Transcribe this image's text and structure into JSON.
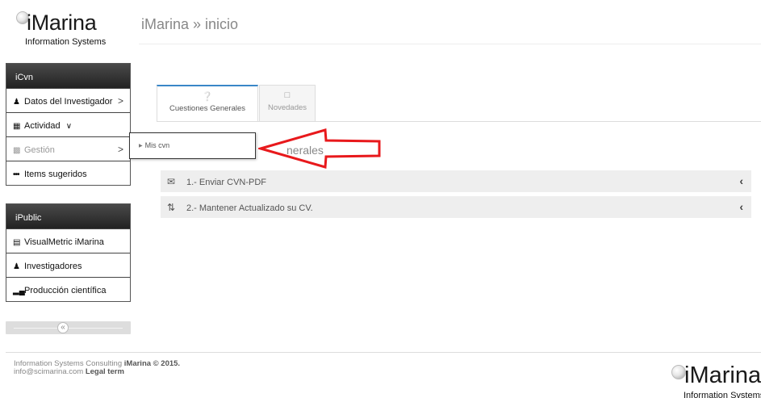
{
  "logo": {
    "brand": "iMarina",
    "subtitle": "Information Systems"
  },
  "page_title": "iMarina » inicio",
  "sidebar": {
    "icvn": {
      "header": "iCvn",
      "items": [
        {
          "label": "Datos del Investigador",
          "icon": "user-icon",
          "suffix": ">"
        },
        {
          "label": "Actividad",
          "icon": "document-icon",
          "suffix": "∨"
        },
        {
          "label": "Gestión",
          "icon": "briefcase-icon",
          "suffix": ">"
        },
        {
          "label": "Items sugeridos",
          "icon": "ellipsis-icon"
        }
      ]
    },
    "ipublic": {
      "header": "iPublic",
      "items": [
        {
          "label": "VisualMetric iMarina",
          "icon": "chart-icon"
        },
        {
          "label": "Investigadores",
          "icon": "users-icon"
        },
        {
          "label": "Producción científica",
          "icon": "bars-icon"
        }
      ]
    },
    "collapse_glyph": "«"
  },
  "submenu": {
    "item": "Mis cvn"
  },
  "tabs": [
    {
      "label": "Cuestiones Generales",
      "icon": "question-circle-icon",
      "active": true
    },
    {
      "label": "Novedades",
      "icon": "file-icon",
      "active": false
    }
  ],
  "section_title": "nerales",
  "accordion": [
    {
      "label": "1.- Enviar CVN-PDF",
      "icon": "envelope-icon",
      "chevron": "‹"
    },
    {
      "label": "2.- Mantener Actualizado su CV.",
      "icon": "sort-icon",
      "chevron": "‹"
    }
  ],
  "footer": {
    "line1_plain": "Information Systems Consulting ",
    "line1_bold": "iMarina © 2015.",
    "line2_plain": "info@scimarina.com ",
    "line2_bold": "Legal term",
    "logo_brand": "iMarina",
    "logo_sub": "Information Systems"
  },
  "colors": {
    "accent": "#3a87c8",
    "annotation": "#e8191c",
    "panel_header": "#333333"
  }
}
